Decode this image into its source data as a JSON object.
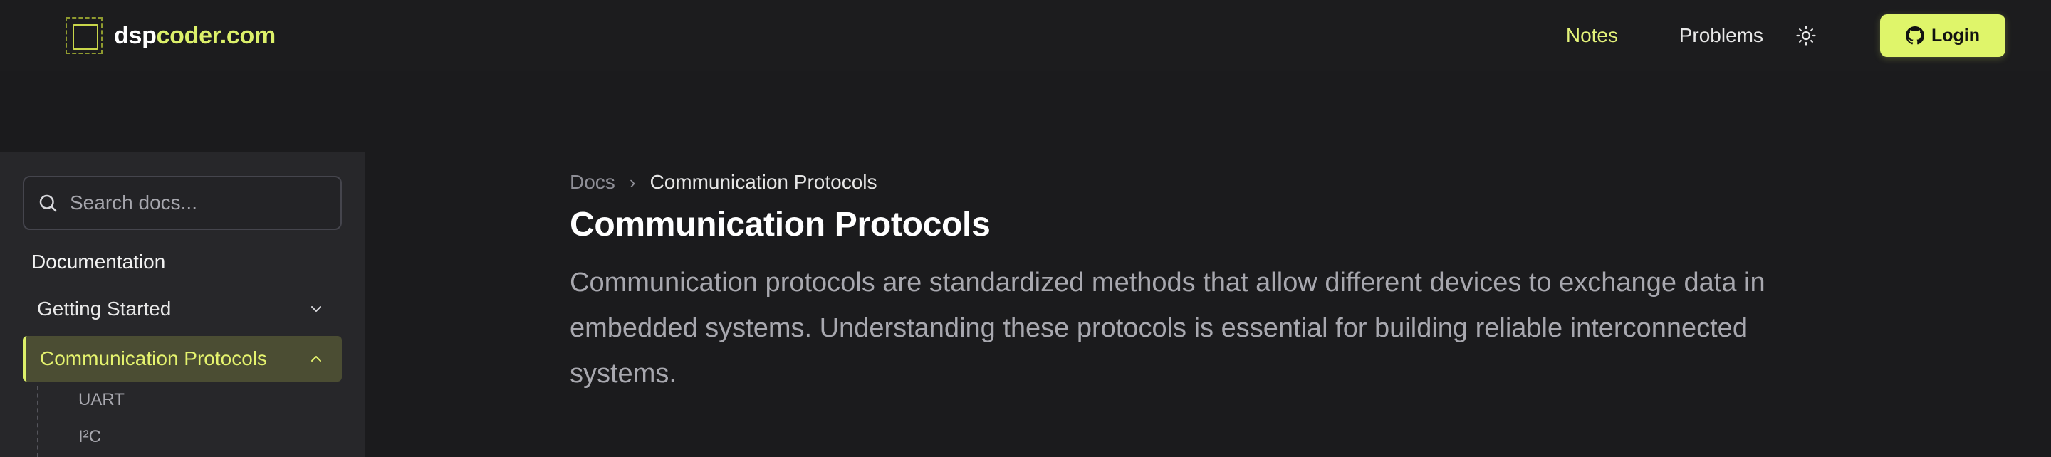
{
  "header": {
    "logo_part1": "dsp",
    "logo_part2": "coder.com",
    "nav": {
      "notes": "Notes",
      "problems": "Problems"
    },
    "login_label": "Login",
    "icons": {
      "theme": "sun-icon",
      "login": "github-icon"
    }
  },
  "sidebar": {
    "search_placeholder": "Search docs...",
    "section_title": "Documentation",
    "items": [
      {
        "label": "Getting Started",
        "expanded": false
      },
      {
        "label": "Communication Protocols",
        "expanded": true,
        "active": true
      }
    ],
    "subitems": [
      "UART",
      "I²C"
    ]
  },
  "main": {
    "breadcrumb": {
      "root": "Docs",
      "separator": "›",
      "current": "Communication Protocols"
    },
    "title": "Communication Protocols",
    "lead": "Communication protocols are standardized methods that allow different devices to exchange data in embedded systems. Understanding these protocols is essential for building reliable interconnected systems."
  },
  "colors": {
    "background": "#1b1b1d",
    "sidebar": "#27272a",
    "accent": "#dff56a",
    "active_item_bg": "#4b4d33",
    "muted_text": "#a8a8af"
  }
}
